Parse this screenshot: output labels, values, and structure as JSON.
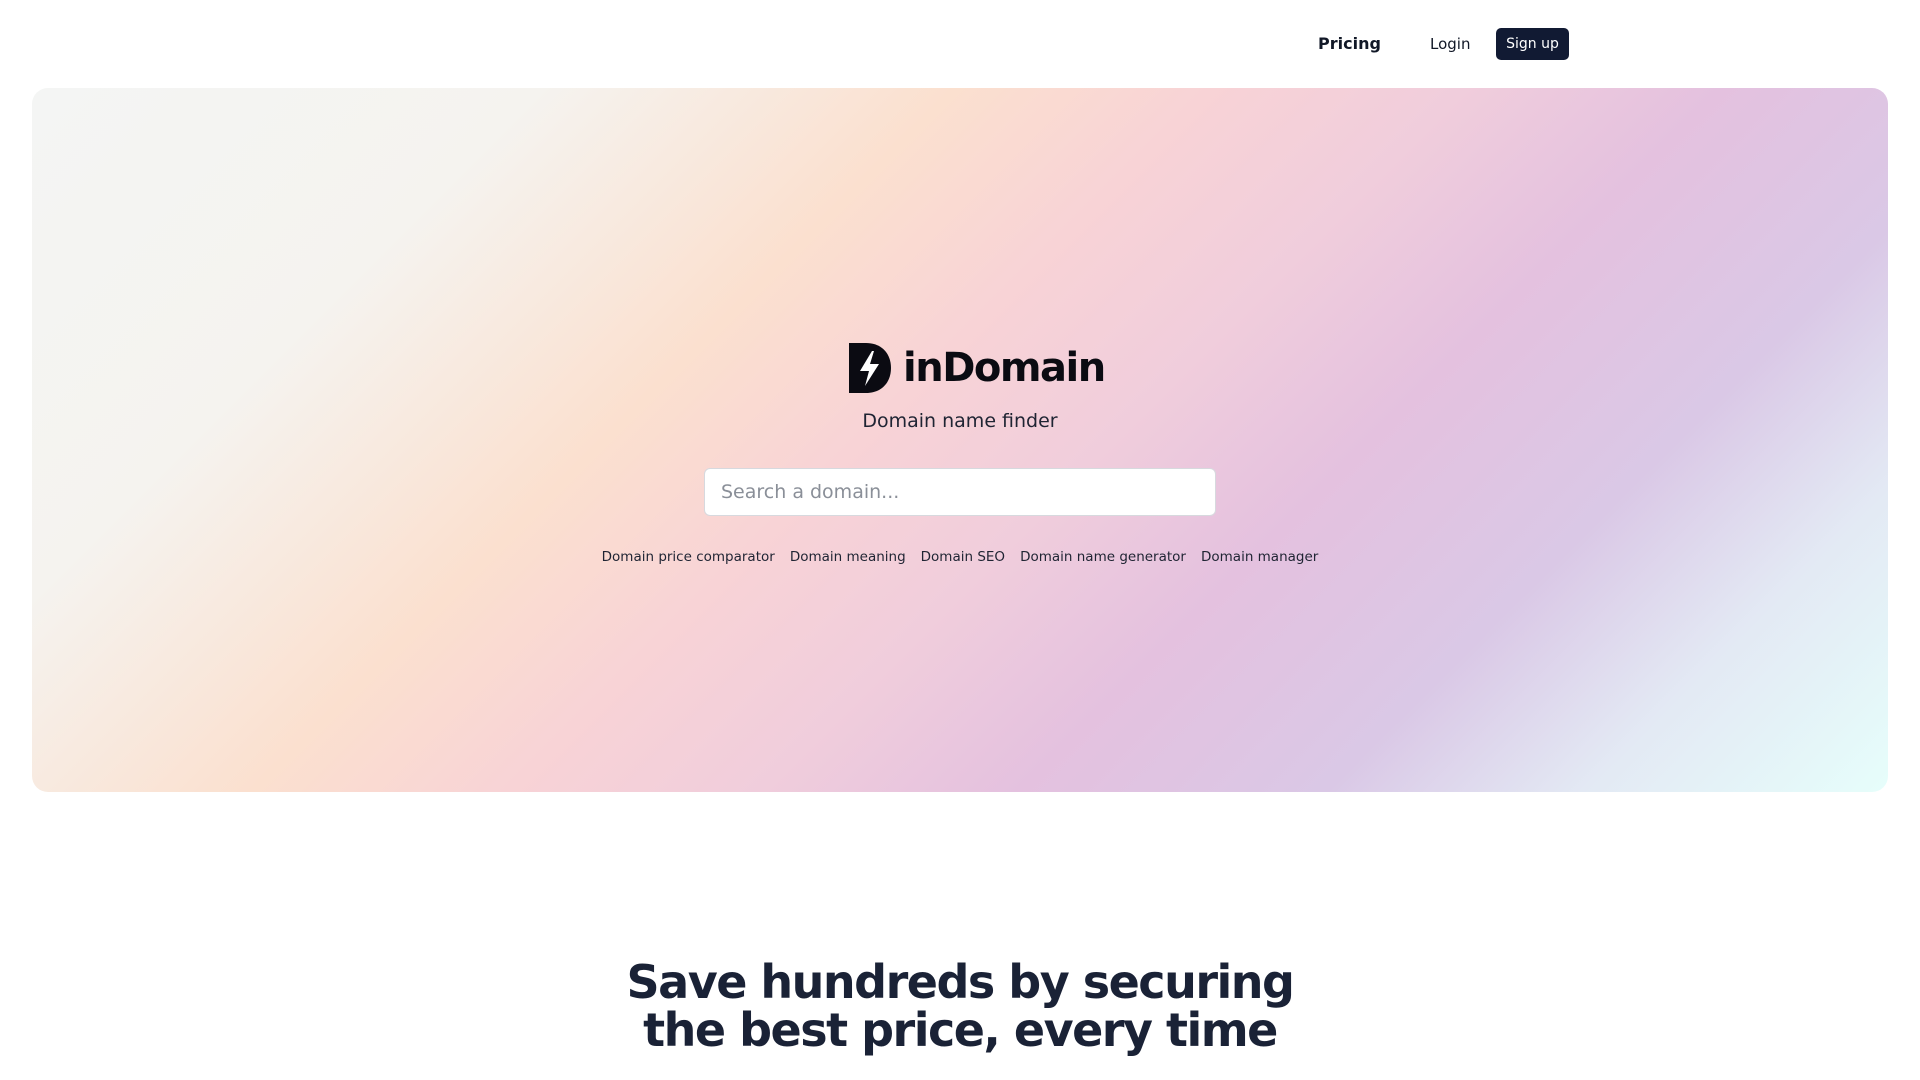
{
  "nav": {
    "pricing_label": "Pricing",
    "login_label": "Login",
    "signup_label": "Sign up"
  },
  "hero": {
    "logo_icon": "lightning-d-logo-icon",
    "brand_name": "inDomain",
    "tagline": "Domain name finder",
    "search": {
      "placeholder": "Search a domain...",
      "value": ""
    },
    "quick_links": [
      "Domain price comparator",
      "Domain meaning",
      "Domain SEO",
      "Domain name generator",
      "Domain manager"
    ]
  },
  "section": {
    "headline_line1": "Save hundreds by securing",
    "headline_line2": "the best price, every time"
  },
  "colors": {
    "signup_bg": "#111a33",
    "headline": "#1a2236",
    "gradient_peach": "#fbe0cf",
    "gradient_pink": "#f8d3d6",
    "gradient_lilac": "#e4c1df",
    "gradient_mint": "#e6fefb"
  }
}
